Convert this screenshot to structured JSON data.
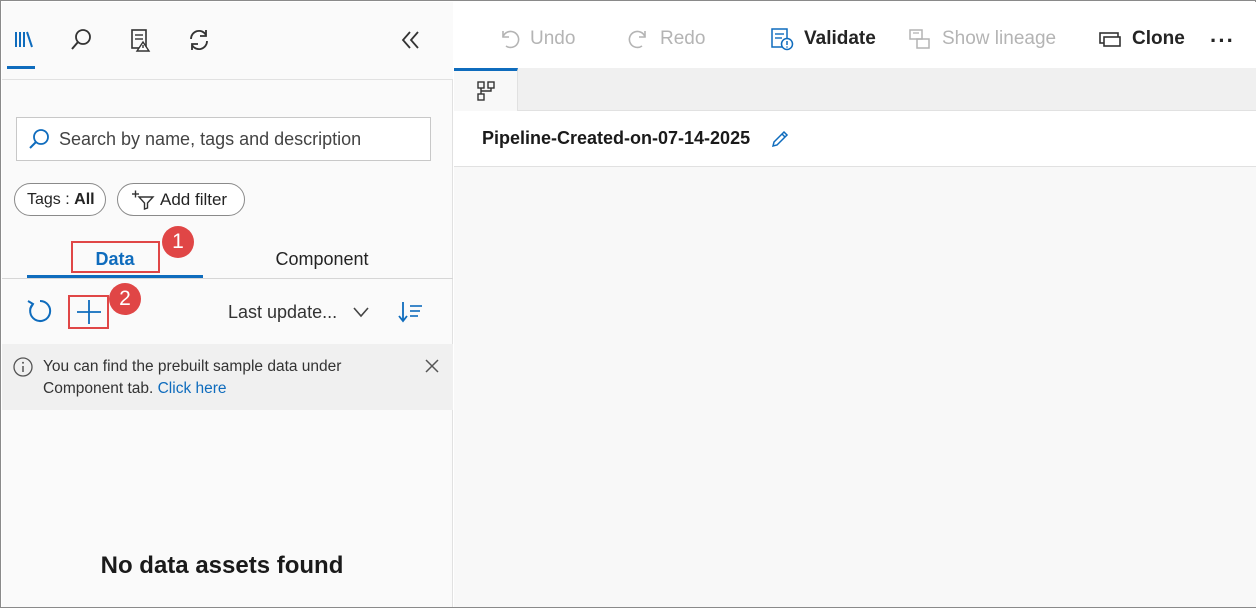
{
  "left_panel": {
    "search": {
      "placeholder": "Search by name, tags and description"
    },
    "tags_filter": {
      "label": "Tags : ",
      "value": "All"
    },
    "add_filter_label": "Add filter",
    "tabs": [
      {
        "label": "Data",
        "active": true
      },
      {
        "label": "Component",
        "active": false
      }
    ],
    "sort": {
      "selected": "Last update..."
    },
    "info": {
      "text": "You can find the prebuilt sample data under Component tab. ",
      "link": "Click here"
    },
    "empty_message": "No data assets found",
    "callouts": [
      "1",
      "2"
    ]
  },
  "toolbar": {
    "undo": "Undo",
    "redo": "Redo",
    "validate": "Validate",
    "show_lineage": "Show lineage",
    "clone": "Clone",
    "more": "···"
  },
  "pipeline": {
    "title": "Pipeline-Created-on-07-14-2025"
  },
  "icons": [
    "library-icon",
    "search-icon",
    "report-icon",
    "sync-icon",
    "collapse-icon",
    "filter-icon",
    "refresh-icon",
    "add-icon",
    "chevron-down-icon",
    "sort-icon",
    "info-icon",
    "close-icon",
    "undo-icon",
    "redo-icon",
    "validate-icon",
    "lineage-icon",
    "clone-icon",
    "pipeline-graph-icon",
    "edit-icon"
  ],
  "colors": {
    "accent": "#0f6cbd",
    "callout": "#e04646"
  }
}
